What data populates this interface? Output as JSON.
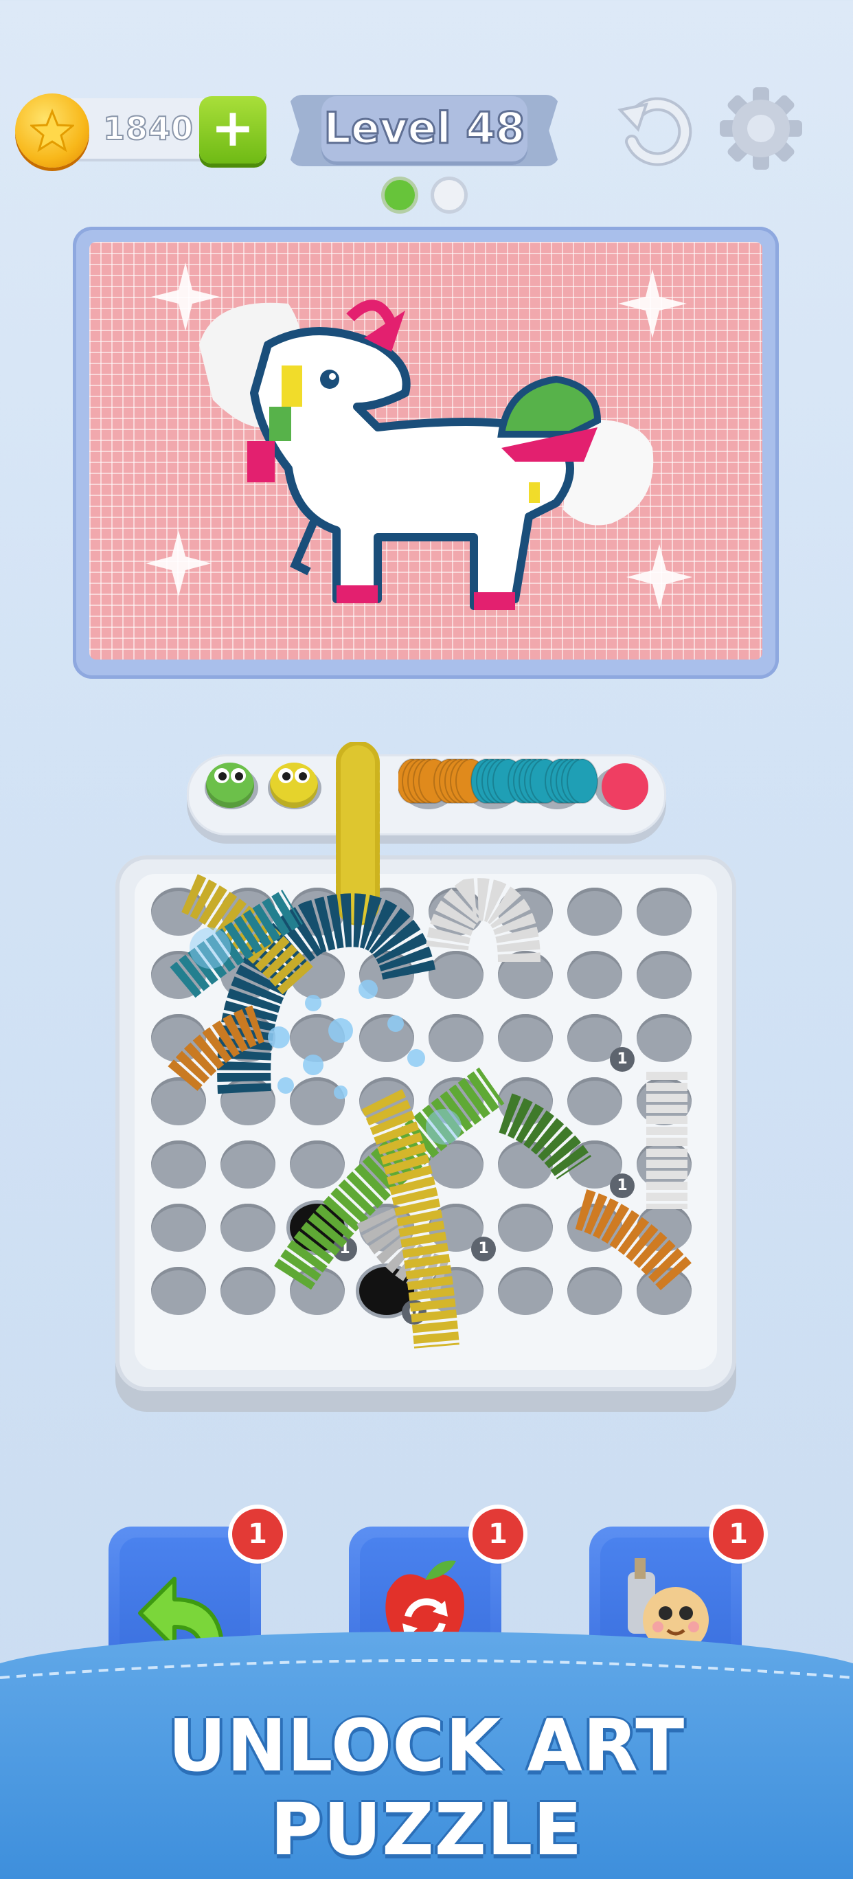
{
  "hud": {
    "coins": "1840",
    "add_coins_symbol": "+",
    "level_label": "Level 48",
    "restart_icon": "restart-icon",
    "settings_icon": "gear-icon"
  },
  "pagination": {
    "count": 2,
    "active_index": 0,
    "active_color": "#67c43a",
    "inactive_color": "#eef1f6"
  },
  "art_panel": {
    "subject": "unicorn-pixel-art",
    "background_color": "#f1a8ad"
  },
  "queue": {
    "waiting_creatures": [
      {
        "color": "#6cc04a",
        "icon": "green-eyes-creature"
      },
      {
        "color": "#e5d32c",
        "icon": "yellow-eyes-creature"
      }
    ],
    "collected_colors": [
      "#e08a1c",
      "#e08a1c",
      "#1f9fb5",
      "#1f9fb5",
      "#1f9fb5",
      "#ef3e62"
    ]
  },
  "board": {
    "rows": 7,
    "cols": 8,
    "hole_counts": [
      "1",
      "1",
      "1",
      "1",
      "1",
      "0"
    ],
    "worm_colors": [
      "#e5c931",
      "#1b6e8c",
      "#d58426",
      "#2a8f9c",
      "#6bb33c",
      "#f2f2f2",
      "#c8c8c8"
    ]
  },
  "boosters": [
    {
      "name": "undo",
      "icon": "undo-arrow-icon",
      "count": "1"
    },
    {
      "name": "shuffle",
      "icon": "apple-shuffle-icon",
      "count": "1"
    },
    {
      "name": "helper",
      "icon": "snail-helper-icon",
      "count": "1"
    }
  ],
  "banner": {
    "text": "UNLOCK ART PUZZLE"
  }
}
